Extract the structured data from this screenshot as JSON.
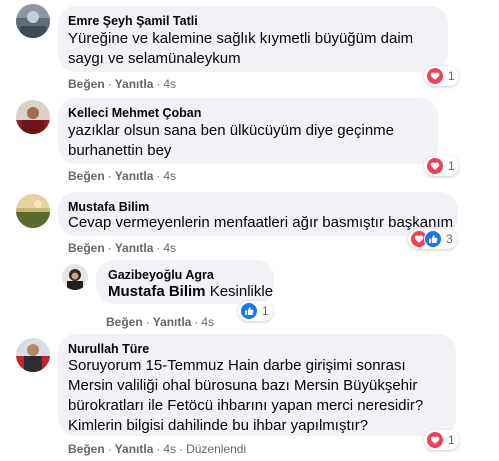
{
  "colors": {
    "bubble": "#f0f2f5",
    "meta_text": "#65676b",
    "love": "#f33e58",
    "like": "#1877f2"
  },
  "actions": {
    "like": "Beğen",
    "reply": "Yanıtla",
    "separator": "·"
  },
  "comments": [
    {
      "author": "Emre Şeyh Şamil Tatli",
      "text_lines": [
        "Yüreğine ve kalemine sağlık kıymetli büyüğüm daim",
        "saygı ve selamünaleykum"
      ],
      "time": "4s",
      "reactions": [
        "heart-icon"
      ],
      "reaction_count": "1"
    },
    {
      "author": "Kelleci Mehmet Çoban",
      "text_lines": [
        "yazıklar olsun sana ben ülkücüyüm diye geçinme",
        "burhanettin bey"
      ],
      "time": "4s",
      "reactions": [
        "heart-icon"
      ],
      "reaction_count": "1"
    },
    {
      "author": "Mustafa Bilim",
      "text_lines": [
        "Cevap vermeyenlerin menfaatleri ağır basmıştır başkanım"
      ],
      "time": "4s",
      "reactions": [
        "heart-icon",
        "like-icon"
      ],
      "reaction_count": "3"
    },
    {
      "author": "Gazibeyoğlu Agra",
      "mention": "Mustafa Bilim",
      "text": "Kesinlikle",
      "time": "4s",
      "reactions": [
        "like-icon"
      ],
      "reaction_count": "1"
    },
    {
      "author": "Nurullah Türe",
      "text_lines": [
        "Soruyorum 15-Temmuz Hain darbe girişimi sonrası",
        "Mersin valiliği ohal bürosuna bazı Mersin Büyükşehir",
        "bürokratları ile Fetöcü ihbarını yapan merci neresidir?",
        "Kimlerin bilgisi dahilinde bu ihbar yapılmıştır?"
      ],
      "time": "4s",
      "edited": "Düzenlendi",
      "reactions": [
        "heart-icon"
      ],
      "reaction_count": "1"
    }
  ]
}
